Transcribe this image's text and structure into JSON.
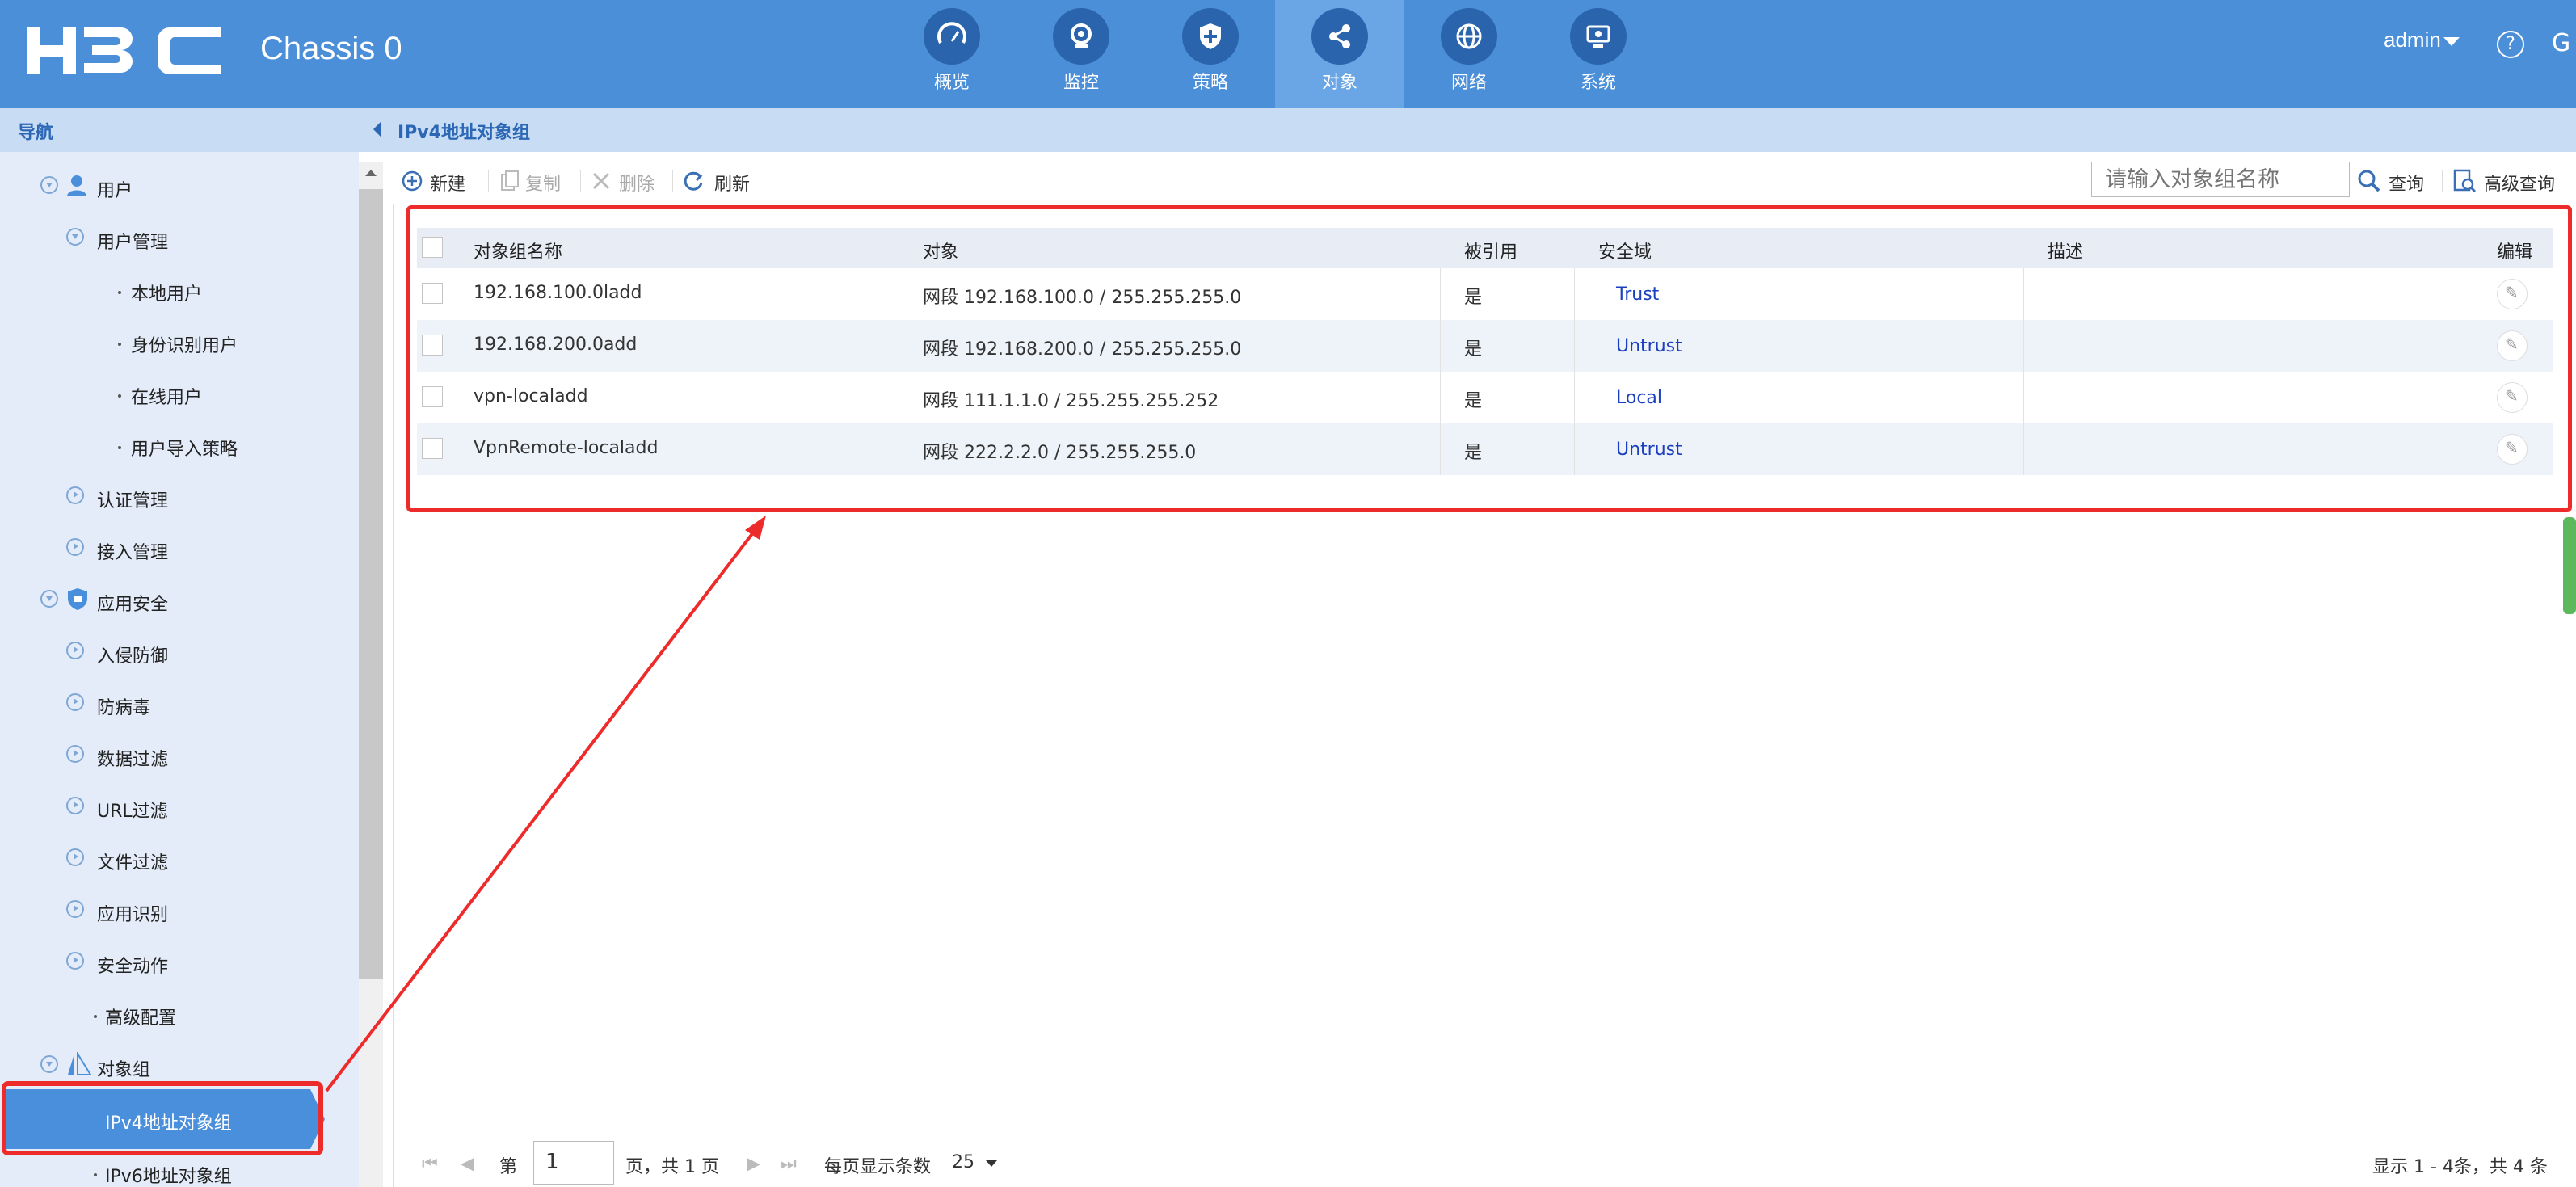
{
  "header": {
    "logo_text": "H3C",
    "chassis": "Chassis 0",
    "nav": [
      {
        "label": "概览",
        "icon": "gauge-icon"
      },
      {
        "label": "监控",
        "icon": "camera-icon"
      },
      {
        "label": "策略",
        "icon": "shield-icon"
      },
      {
        "label": "对象",
        "icon": "share-icon",
        "active": true
      },
      {
        "label": "网络",
        "icon": "globe-icon"
      },
      {
        "label": "系统",
        "icon": "monitor-icon"
      }
    ],
    "user": "admin",
    "help": "?",
    "refresh": "G"
  },
  "sidebar": {
    "title": "导航",
    "items": [
      {
        "label": "用户"
      },
      {
        "label": "用户管理"
      },
      {
        "label": "本地用户"
      },
      {
        "label": "身份识别用户"
      },
      {
        "label": "在线用户"
      },
      {
        "label": "用户导入策略"
      },
      {
        "label": "认证管理"
      },
      {
        "label": "接入管理"
      },
      {
        "label": "应用安全"
      },
      {
        "label": "入侵防御"
      },
      {
        "label": "防病毒"
      },
      {
        "label": "数据过滤"
      },
      {
        "label": "URL过滤"
      },
      {
        "label": "文件过滤"
      },
      {
        "label": "应用识别"
      },
      {
        "label": "安全动作"
      },
      {
        "label": "高级配置"
      },
      {
        "label": "对象组"
      },
      {
        "label": "IPv4地址对象组"
      },
      {
        "label": "IPv6地址对象组"
      }
    ]
  },
  "main": {
    "title": "IPv4地址对象组",
    "toolbar": {
      "new": "新建",
      "copy": "复制",
      "delete": "删除",
      "refresh": "刷新",
      "search_placeholder": "请输入对象组名称",
      "query": "查询",
      "advanced_query": "高级查询"
    },
    "columns": [
      "对象组名称",
      "对象",
      "被引用",
      "安全域",
      "描述",
      "编辑"
    ],
    "rows": [
      {
        "name": "192.168.100.0ladd",
        "object": "网段 192.168.100.0 / 255.255.255.0",
        "referenced": "是",
        "zone": "Trust",
        "desc": ""
      },
      {
        "name": "192.168.200.0add",
        "object": "网段 192.168.200.0 / 255.255.255.0",
        "referenced": "是",
        "zone": "Untrust",
        "desc": ""
      },
      {
        "name": "vpn-localadd",
        "object": "网段 111.1.1.0 / 255.255.255.252",
        "referenced": "是",
        "zone": "Local",
        "desc": ""
      },
      {
        "name": "VpnRemote-localadd",
        "object": "网段 222.2.2.0 / 255.255.255.0",
        "referenced": "是",
        "zone": "Untrust",
        "desc": ""
      }
    ],
    "pager": {
      "page_prefix": "第",
      "page_value": "1",
      "page_suffix": "页，共 1 页",
      "per_page_label": "每页显示条数",
      "per_page_value": "25",
      "summary": "显示 1 - 4条，共 4 条"
    }
  }
}
